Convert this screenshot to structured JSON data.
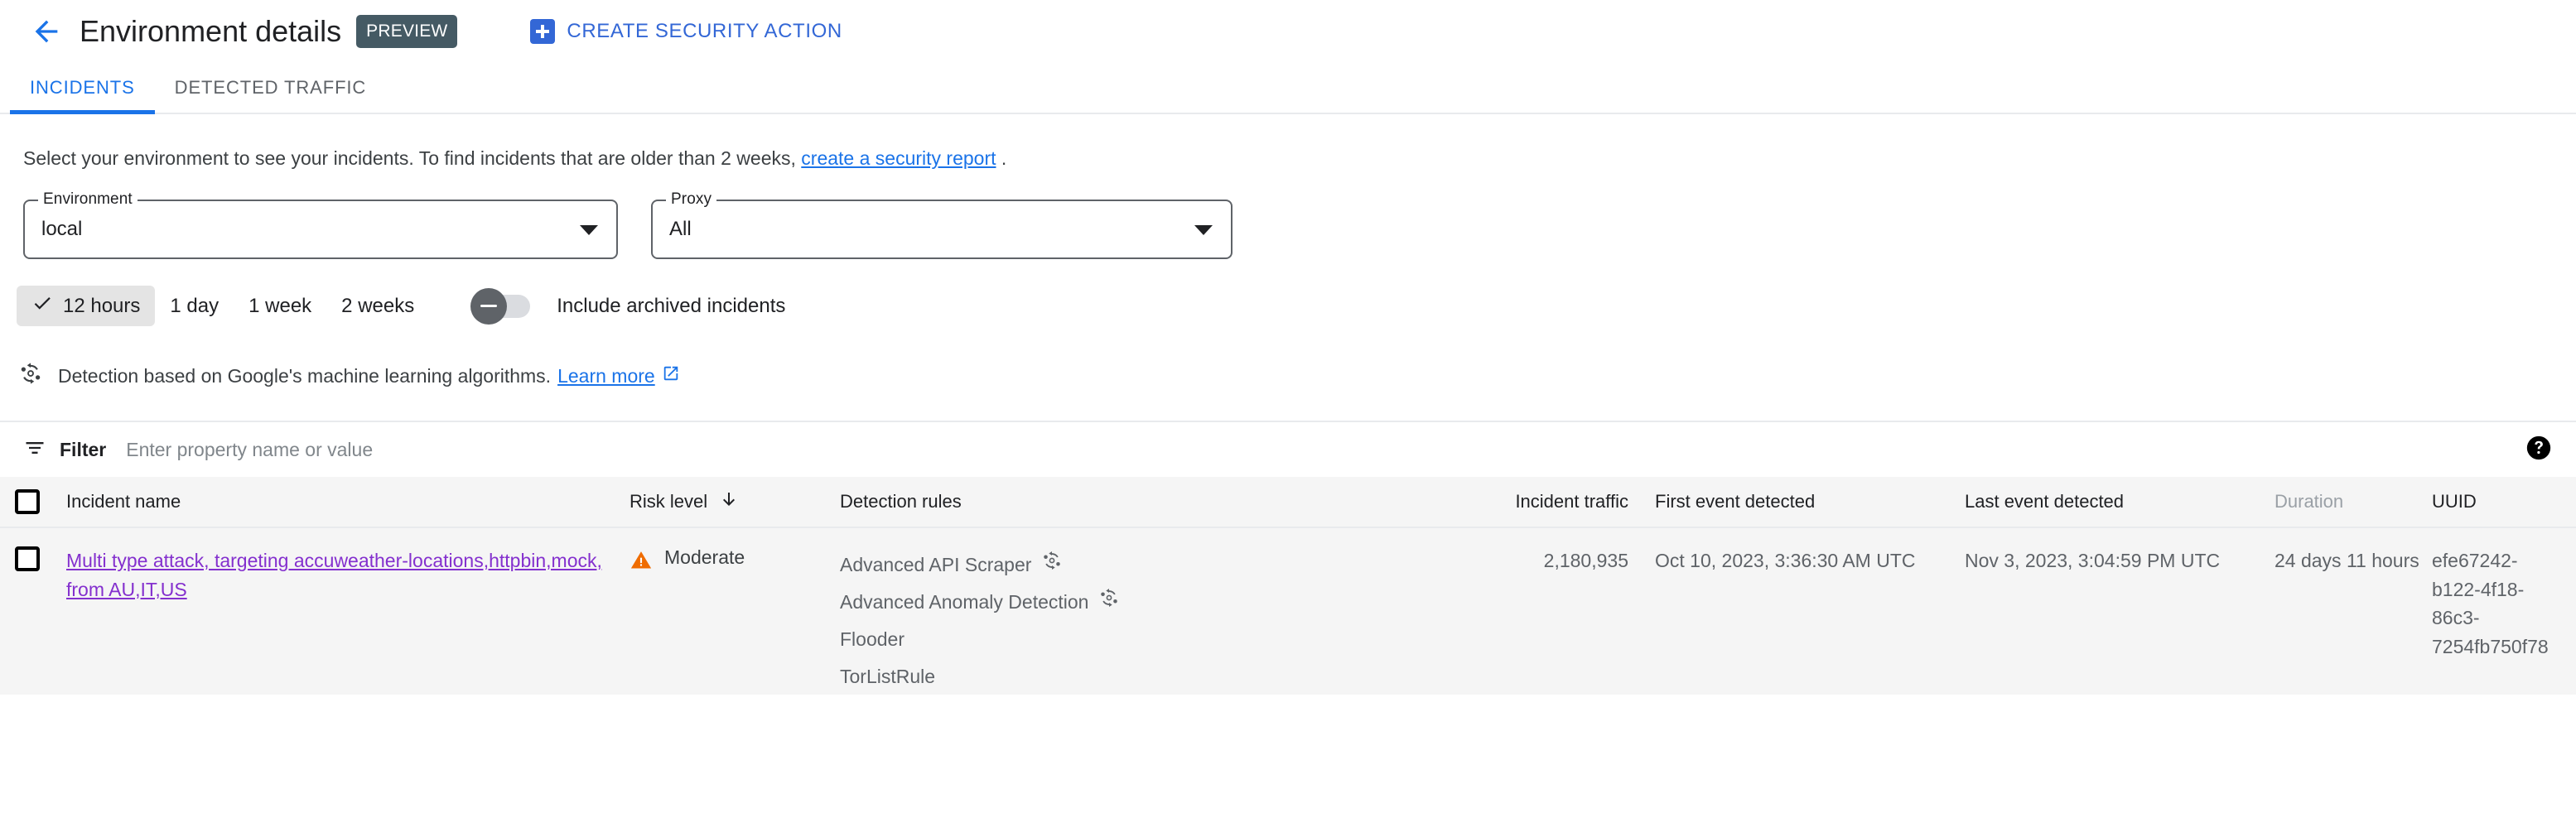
{
  "header": {
    "back_icon": "arrow-back-icon",
    "title": "Environment details",
    "preview_badge": "PREVIEW",
    "create_action": {
      "icon": "add-box-icon",
      "label": "CREATE SECURITY ACTION"
    }
  },
  "tabs": [
    {
      "label": "INCIDENTS",
      "active": true
    },
    {
      "label": "DETECTED TRAFFIC",
      "active": false
    }
  ],
  "intro": {
    "text_before": "Select your environment to see your incidents. To find incidents that are older than 2 weeks,",
    "link": "create a security report",
    "text_after": "."
  },
  "filters": {
    "environment": {
      "label": "Environment",
      "value": "local",
      "arrow_icon": "chevron-down-icon"
    },
    "proxy": {
      "label": "Proxy",
      "value": "All",
      "arrow_icon": "chevron-down-icon"
    },
    "ranges": [
      {
        "label": "12 hours",
        "selected": true
      },
      {
        "label": "1 day",
        "selected": false
      },
      {
        "label": "1 week",
        "selected": false
      },
      {
        "label": "2 weeks",
        "selected": false
      }
    ],
    "archived_toggle": {
      "label": "Include archived incidents",
      "state": "off"
    }
  },
  "ml_notice": {
    "icon": "ml-detection-icon",
    "text": "Detection based on Google's machine learning algorithms.",
    "link": "Learn more",
    "link_icon": "open-in-new-icon"
  },
  "filter_bar": {
    "icon": "filter-icon",
    "label": "Filter",
    "placeholder": "Enter property name or value",
    "value": "",
    "help_icon": "help-icon"
  },
  "table": {
    "columns": {
      "incident_name": "Incident name",
      "risk_level": "Risk level",
      "detection_rules": "Detection rules",
      "incident_traffic": "Incident traffic",
      "first_event": "First event detected",
      "last_event": "Last event detected",
      "duration": "Duration",
      "uuid": "UUID"
    },
    "sort_icon": "arrow-downward-icon",
    "rows": [
      {
        "incident_name": "Multi type attack, targeting accuweather-locations,httpbin,mock, from AU,IT,US",
        "risk_level": "Moderate",
        "risk_icon": "warning-triangle-icon",
        "rules": [
          {
            "name": "Advanced API Scraper",
            "ml": true
          },
          {
            "name": "Advanced Anomaly Detection",
            "ml": true
          },
          {
            "name": "Flooder",
            "ml": false
          },
          {
            "name": "TorListRule",
            "ml": false
          }
        ],
        "incident_traffic": "2,180,935",
        "first_event": "Oct 10, 2023, 3:36:30 AM UTC",
        "last_event": "Nov 3, 2023, 3:04:59 PM UTC",
        "duration": "24 days 11 hours",
        "uuid": "efe67242-b122-4f18-86c3-7254fb750f78"
      }
    ]
  },
  "colors": {
    "accent_blue": "#1a73e8",
    "link_blue": "#3367d6",
    "visited_purple": "#8430ce",
    "warning_orange": "#ef6c00",
    "preview_chip": "#455a64",
    "table_bg": "#f5f5f5"
  }
}
